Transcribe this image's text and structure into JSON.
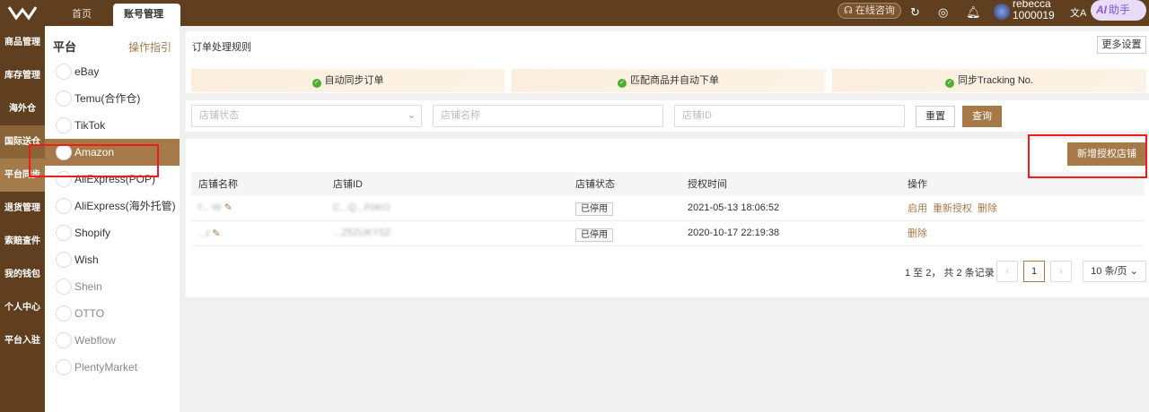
{
  "topbar": {
    "tabs": [
      "首页",
      "账号管理"
    ],
    "consult": "在线咨询",
    "user_name": "rebecca",
    "user_id": "1000019",
    "ai_label": "AI",
    "ai_text": "助手"
  },
  "nav": [
    "商品管理",
    "库存管理",
    "海外仓",
    "国际送仓",
    "平台同步",
    "退货管理",
    "索赔查件",
    "我的钱包",
    "个人中心",
    "平台入驻"
  ],
  "platforms": {
    "title": "平台",
    "guide": "操作指引",
    "items": [
      {
        "name": "eBay",
        "icon": "ebay"
      },
      {
        "name": "Temu(合作仓)",
        "icon": "TEMU"
      },
      {
        "name": "TikTok",
        "icon": "tiktok"
      },
      {
        "name": "Amazon",
        "icon": "amazon"
      },
      {
        "name": "AliExpress(POP)",
        "icon": "aliexpress"
      },
      {
        "name": "AliExpress(海外托管)",
        "icon": "aliexpress"
      },
      {
        "name": "Shopify",
        "icon": "shopify"
      },
      {
        "name": "Wish",
        "icon": "wish"
      },
      {
        "name": "Shein",
        "icon": "shein"
      },
      {
        "name": "OTTO",
        "icon": "otto"
      },
      {
        "name": "Webflow",
        "icon": "webflow"
      },
      {
        "name": "PlentyMarket",
        "icon": "plentymarket"
      }
    ]
  },
  "rules": {
    "title": "订单处理规则",
    "more": "更多设置",
    "items": [
      "自动同步订单",
      "匹配商品并自动下单",
      "同步Tracking No."
    ]
  },
  "filters": {
    "status_placeholder": "店铺状态",
    "name_placeholder": "店铺名称",
    "id_placeholder": "店铺ID",
    "reset": "重置",
    "query": "查询"
  },
  "add_store": "新增授权店铺",
  "table": {
    "headers": [
      "店铺名称",
      "店铺ID",
      "店铺状态",
      "授权时间",
      "操作"
    ],
    "rows": [
      {
        "name": "f... W",
        "id": "C...Q...F0KO",
        "status": "已停用",
        "time": "2021-05-13 18:06:52",
        "actions": [
          "启用",
          "重新授权",
          "删除"
        ]
      },
      {
        "name": "...t",
        "id": "...Z5ZUKY5Z",
        "status": "已停用",
        "time": "2020-10-17 22:19:38",
        "actions": [
          "删除"
        ]
      }
    ]
  },
  "pagination": {
    "summary": "1 至 2，  共 2 条记录",
    "page": "1",
    "size": "10 条/页"
  },
  "colors": {
    "brand": "#5f3f1f",
    "accent": "#a57a48",
    "highlight": "#f01c1c"
  }
}
